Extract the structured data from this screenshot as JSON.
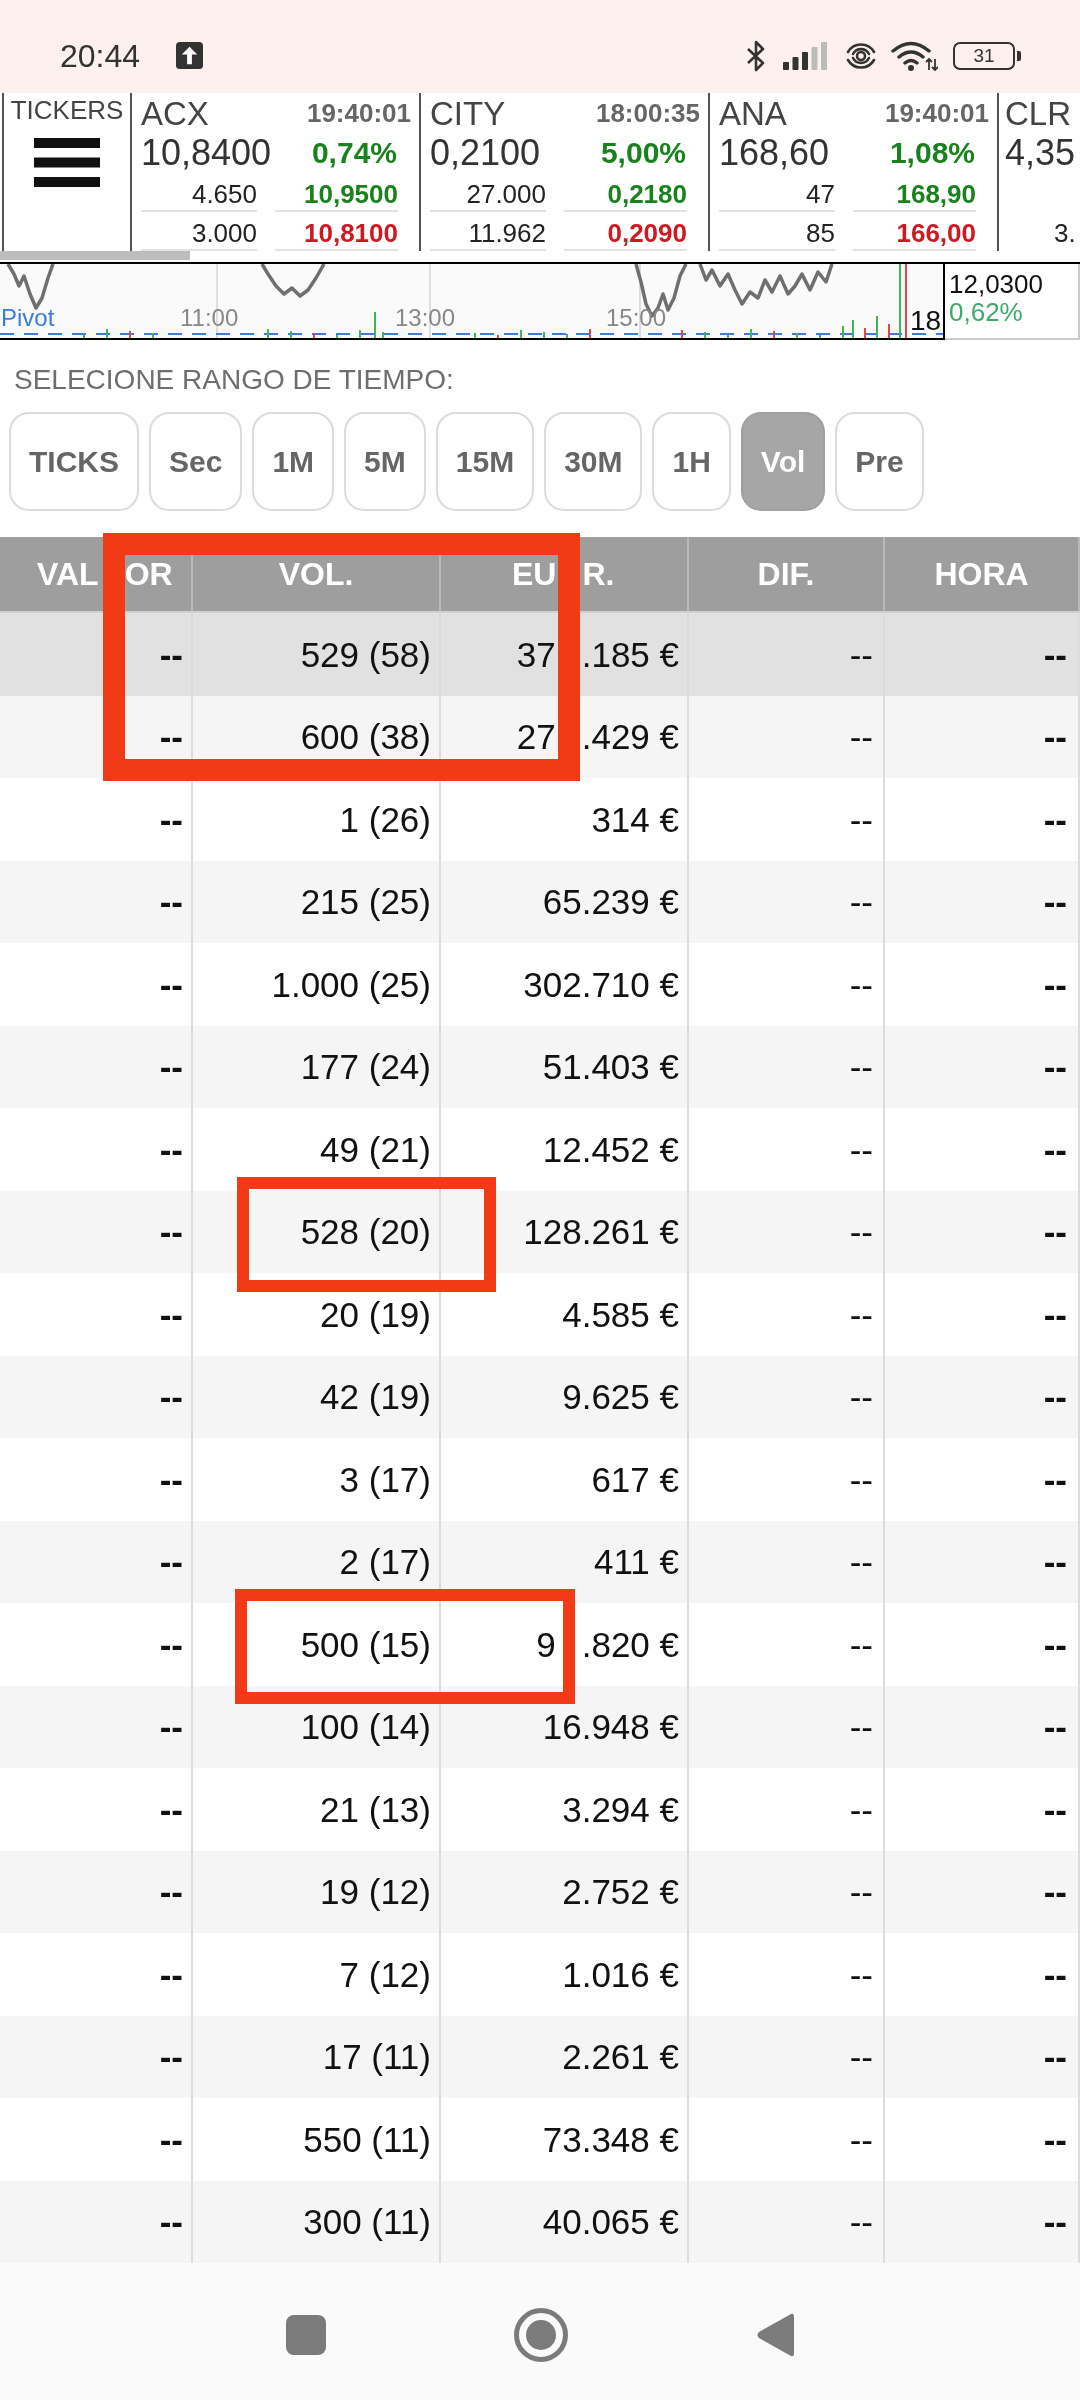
{
  "status_bar": {
    "time": "20:44",
    "battery": "31"
  },
  "ticker_strip": {
    "menu_label": "TICKERS",
    "tickers": [
      {
        "kind": "full",
        "symbol": "ACX",
        "time": "19:40:01",
        "price": "10,8400",
        "change": "0,74%",
        "bid_volume": "4.650",
        "bid": "10,9500",
        "ask_volume": "3.000",
        "ask": "10,8100"
      },
      {
        "kind": "full",
        "symbol": "CITY",
        "time": "18:00:35",
        "price": "0,2100",
        "change": "5,00%",
        "bid_volume": "27.000",
        "bid": "0,2180",
        "ask_volume": "11.962",
        "ask": "0,2090"
      },
      {
        "kind": "full",
        "symbol": "ANA",
        "time": "19:40:01",
        "price": "168,60",
        "change": "1,08%",
        "bid_volume": "47",
        "bid": "168,90",
        "ask_volume": "85",
        "ask": "166,00"
      },
      {
        "kind": "partial",
        "symbol": "CLR",
        "price": "4,35",
        "ask_volume": "3."
      }
    ]
  },
  "intraday_chart": {
    "pivot_label": "Pivot",
    "time_labels": [
      "11:00",
      "13:00",
      "15:00",
      "18"
    ],
    "last_price": "12,0300",
    "last_change": "0,62%"
  },
  "range_selector": {
    "label": "SELECIONE RANGO DE TIEMPO:",
    "options": [
      {
        "label": "TICKS",
        "selected": false
      },
      {
        "label": "Sec",
        "selected": false
      },
      {
        "label": "1M",
        "selected": false
      },
      {
        "label": "5M",
        "selected": false
      },
      {
        "label": "15M",
        "selected": false
      },
      {
        "label": "30M",
        "selected": false
      },
      {
        "label": "1H",
        "selected": false
      },
      {
        "label": "Vol",
        "selected": true
      },
      {
        "label": "Pre",
        "selected": false
      }
    ]
  },
  "table": {
    "columns": [
      [
        "VAL",
        "OR"
      ],
      "VOL.",
      [
        "EU",
        "R."
      ],
      "DIF.",
      "HORA"
    ],
    "rows": [
      {
        "selected": true,
        "cells": [
          "--",
          "529 (58)",
          [
            "37",
            ".185 €"
          ],
          "--",
          "--"
        ]
      },
      {
        "selected": false,
        "cells": [
          "--",
          "600 (38)",
          [
            "27",
            ".429 €"
          ],
          "--",
          "--"
        ]
      },
      {
        "selected": false,
        "cells": [
          "--",
          "1 (26)",
          "314 €",
          "--",
          "--"
        ]
      },
      {
        "selected": false,
        "cells": [
          "--",
          "215 (25)",
          "65.239 €",
          "--",
          "--"
        ]
      },
      {
        "selected": false,
        "cells": [
          "--",
          "1.000 (25)",
          "302.710 €",
          "--",
          "--"
        ]
      },
      {
        "selected": false,
        "cells": [
          "--",
          "177 (24)",
          "51.403 €",
          "--",
          "--"
        ]
      },
      {
        "selected": false,
        "cells": [
          "--",
          "49 (21)",
          "12.452 €",
          "--",
          "--"
        ]
      },
      {
        "selected": false,
        "cells": [
          "--",
          "528 (20)",
          "128.261 €",
          "--",
          "--"
        ]
      },
      {
        "selected": false,
        "cells": [
          "--",
          "20 (19)",
          "4.585 €",
          "--",
          "--"
        ]
      },
      {
        "selected": false,
        "cells": [
          "--",
          "42 (19)",
          "9.625 €",
          "--",
          "--"
        ]
      },
      {
        "selected": false,
        "cells": [
          "--",
          "3 (17)",
          "617 €",
          "--",
          "--"
        ]
      },
      {
        "selected": false,
        "cells": [
          "--",
          "2 (17)",
          "411 €",
          "--",
          "--"
        ]
      },
      {
        "selected": false,
        "cells": [
          "--",
          "500 (15)",
          [
            "9",
            ".820 €"
          ],
          "--",
          "--"
        ]
      },
      {
        "selected": false,
        "cells": [
          "--",
          "100 (14)",
          "16.948 €",
          "--",
          "--"
        ]
      },
      {
        "selected": false,
        "cells": [
          "--",
          "21 (13)",
          "3.294 €",
          "--",
          "--"
        ]
      },
      {
        "selected": false,
        "cells": [
          "--",
          "19 (12)",
          "2.752 €",
          "--",
          "--"
        ]
      },
      {
        "selected": false,
        "cells": [
          "--",
          "7 (12)",
          "1.016 €",
          "--",
          "--"
        ]
      },
      {
        "selected": false,
        "cells": [
          "--",
          "17 (11)",
          "2.261 €",
          "--",
          "--"
        ]
      },
      {
        "selected": false,
        "cells": [
          "--",
          "550 (11)",
          "73.348 €",
          "--",
          "--"
        ]
      },
      {
        "selected": false,
        "cells": [
          "--",
          "300 (11)",
          "40.065 €",
          "--",
          "--"
        ]
      }
    ]
  }
}
